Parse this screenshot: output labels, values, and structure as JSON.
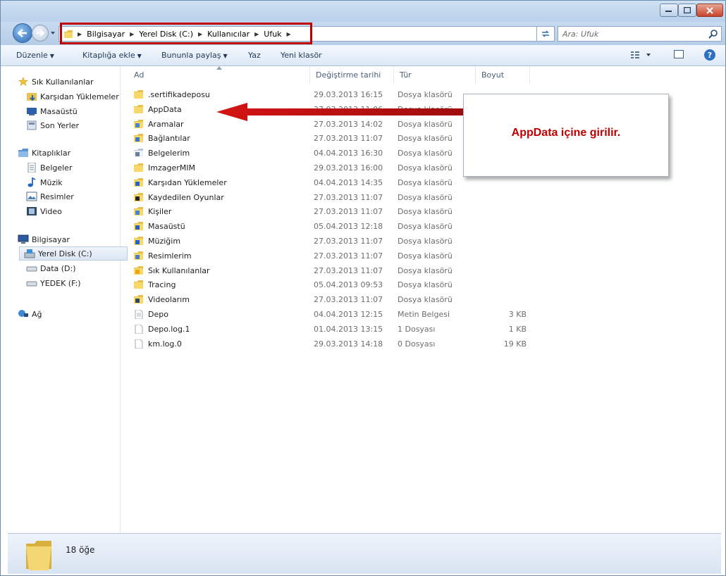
{
  "address": {
    "crumbs": [
      "Bilgisayar",
      "Yerel Disk (C:)",
      "Kullanıcılar",
      "Ufuk"
    ]
  },
  "search": {
    "placeholder": "Ara: Ufuk"
  },
  "toolbar": {
    "organize": "Düzenle",
    "include_in_library": "Kitaplığa ekle",
    "share_with": "Bununla paylaş",
    "burn": "Yaz",
    "new_folder": "Yeni klasör"
  },
  "sidebar": {
    "favorites": {
      "label": "Sık Kullanılanlar",
      "items": [
        "Karşıdan Yüklemeler",
        "Masaüstü",
        "Son Yerler"
      ]
    },
    "libraries": {
      "label": "Kitaplıklar",
      "items": [
        "Belgeler",
        "Müzik",
        "Resimler",
        "Video"
      ]
    },
    "computer": {
      "label": "Bilgisayar",
      "items": [
        "Yerel Disk (C:)",
        "Data (D:)",
        "YEDEK (F:)"
      ]
    },
    "network": {
      "label": "Ağ"
    }
  },
  "columns": {
    "name": "Ad",
    "date": "Değiştirme tarihi",
    "type": "Tür",
    "size": "Boyut"
  },
  "files": [
    {
      "name": ".sertifikadeposu",
      "date": "29.03.2013 16:15",
      "type": "Dosya klasörü",
      "size": "",
      "icon": "folder-icon"
    },
    {
      "name": "AppData",
      "date": "27.03.2013 11:06",
      "type": "Dosya klasörü",
      "size": "",
      "icon": "folder-icon"
    },
    {
      "name": "Aramalar",
      "date": "27.03.2013 14:02",
      "type": "Dosya klasörü",
      "size": "",
      "icon": "searches-folder-icon"
    },
    {
      "name": "Bağlantılar",
      "date": "27.03.2013 11:07",
      "type": "Dosya klasörü",
      "size": "",
      "icon": "links-folder-icon"
    },
    {
      "name": "Belgelerim",
      "date": "04.04.2013 16:30",
      "type": "Dosya klasörü",
      "size": "",
      "icon": "documents-folder-icon"
    },
    {
      "name": "ImzagerMIM",
      "date": "29.03.2013 16:00",
      "type": "Dosya klasörü",
      "size": "",
      "icon": "folder-icon"
    },
    {
      "name": "Karşıdan Yüklemeler",
      "date": "04.04.2013 14:35",
      "type": "Dosya klasörü",
      "size": "",
      "icon": "downloads-folder-icon"
    },
    {
      "name": "Kaydedilen Oyunlar",
      "date": "27.03.2013 11:07",
      "type": "Dosya klasörü",
      "size": "",
      "icon": "saved-games-folder-icon"
    },
    {
      "name": "Kişiler",
      "date": "27.03.2013 11:07",
      "type": "Dosya klasörü",
      "size": "",
      "icon": "contacts-folder-icon"
    },
    {
      "name": "Masaüstü",
      "date": "05.04.2013 12:18",
      "type": "Dosya klasörü",
      "size": "",
      "icon": "desktop-folder-icon"
    },
    {
      "name": "Müziğim",
      "date": "27.03.2013 11:07",
      "type": "Dosya klasörü",
      "size": "",
      "icon": "music-folder-icon"
    },
    {
      "name": "Resimlerim",
      "date": "27.03.2013 11:07",
      "type": "Dosya klasörü",
      "size": "",
      "icon": "pictures-folder-icon"
    },
    {
      "name": "Sık Kullanılanlar",
      "date": "27.03.2013 11:07",
      "type": "Dosya klasörü",
      "size": "",
      "icon": "favorites-folder-icon"
    },
    {
      "name": "Tracing",
      "date": "05.04.2013 09:53",
      "type": "Dosya klasörü",
      "size": "",
      "icon": "folder-icon"
    },
    {
      "name": "Videolarım",
      "date": "27.03.2013 11:07",
      "type": "Dosya klasörü",
      "size": "",
      "icon": "videos-folder-icon"
    },
    {
      "name": "Depo",
      "date": "04.04.2013 12:15",
      "type": "Metin Belgesi",
      "size": "3 KB",
      "icon": "text-file-icon"
    },
    {
      "name": "Depo.log.1",
      "date": "01.04.2013 13:15",
      "type": "1 Dosyası",
      "size": "1 KB",
      "icon": "file-icon"
    },
    {
      "name": "km.log.0",
      "date": "29.03.2013 14:18",
      "type": "0 Dosyası",
      "size": "19 KB",
      "icon": "file-icon"
    }
  ],
  "annotation": {
    "text": "AppData içine girilir.",
    "color": "#c00000"
  },
  "status": {
    "count": "18 öğe"
  }
}
